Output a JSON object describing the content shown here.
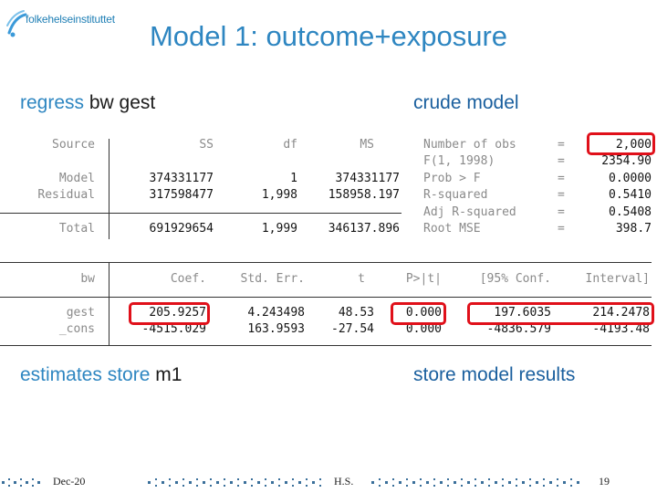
{
  "logo": {
    "text": "folkehelseinstituttet"
  },
  "title": "Model 1: outcome+exposure",
  "command1": {
    "keyword": "regress",
    "args": "bw gest"
  },
  "note1": "crude model",
  "anova": {
    "headers": [
      "Source",
      "SS",
      "df",
      "MS"
    ],
    "rows": [
      {
        "source": "Model",
        "ss": "374331177",
        "df": "1",
        "ms": "374331177"
      },
      {
        "source": "Residual",
        "ss": "317598477",
        "df": "1,998",
        "ms": "158958.197"
      },
      {
        "source": "Total",
        "ss": "691929654",
        "df": "1,999",
        "ms": "346137.896"
      }
    ]
  },
  "fit_stats": [
    {
      "label": "Number of obs",
      "eq": "=",
      "value": "2,000"
    },
    {
      "label": "F(1, 1998)",
      "eq": "=",
      "value": "2354.90"
    },
    {
      "label": "Prob > F",
      "eq": "=",
      "value": "0.0000"
    },
    {
      "label": "R-squared",
      "eq": "=",
      "value": "0.5410"
    },
    {
      "label": "Adj R-squared",
      "eq": "=",
      "value": "0.5408"
    },
    {
      "label": "Root MSE",
      "eq": "=",
      "value": "398.7"
    }
  ],
  "coef_table": {
    "headers": [
      "bw",
      "Coef.",
      "Std. Err.",
      "t",
      "P>|t|",
      "[95% Conf.",
      "Interval]"
    ],
    "rows": [
      {
        "var": "gest",
        "coef": "205.9257",
        "se": "4.243498",
        "t": "48.53",
        "p": "0.000",
        "lo": "197.6035",
        "hi": "214.2478"
      },
      {
        "var": "_cons",
        "coef": "-4515.029",
        "se": "163.9593",
        "t": "-27.54",
        "p": "0.000",
        "lo": "-4836.579",
        "hi": "-4193.48"
      }
    ]
  },
  "command2": {
    "keyword": "estimates store",
    "args": "m1"
  },
  "note2": "store model results",
  "footer": {
    "date": "Dec-20",
    "author": "H.S.",
    "page": "19"
  },
  "colors": {
    "accent": "#2e86c1",
    "highlight": "#e0101a"
  }
}
